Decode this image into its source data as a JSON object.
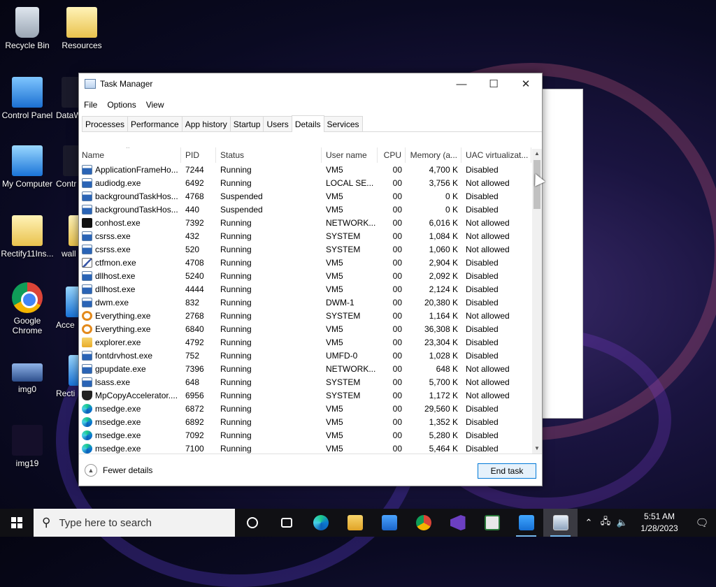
{
  "desktop": {
    "icons": [
      {
        "label": "Recycle Bin"
      },
      {
        "label": "Resources"
      },
      {
        "label": "Control Panel"
      },
      {
        "label": "DataW"
      },
      {
        "label": "My Computer"
      },
      {
        "label": "Contr"
      },
      {
        "label": "Rectify11Ins..."
      },
      {
        "label": "wall"
      },
      {
        "label": "Google Chrome"
      },
      {
        "label": "Acce"
      },
      {
        "label": "img0"
      },
      {
        "label": "Recti"
      },
      {
        "label": "img19"
      }
    ]
  },
  "window": {
    "title": "Task Manager",
    "minimize": "—",
    "maximize": "☐",
    "close": "✕",
    "menu": [
      "File",
      "Options",
      "View"
    ],
    "tabs": [
      "Processes",
      "Performance",
      "App history",
      "Startup",
      "Users",
      "Details",
      "Services"
    ],
    "active_tab": "Details",
    "columns": [
      "Name",
      "PID",
      "Status",
      "User name",
      "CPU",
      "Memory (a...",
      "UAC virtualizat..."
    ],
    "sort_arrow": "^",
    "rows": [
      {
        "name": "ApplicationFrameHo...",
        "pid": "7244",
        "status": "Running",
        "user": "VM5",
        "cpu": "00",
        "mem": "4,700 K",
        "uac": "Disabled",
        "icon": "window-icon"
      },
      {
        "name": "audiodg.exe",
        "pid": "6492",
        "status": "Running",
        "user": "LOCAL SE...",
        "cpu": "00",
        "mem": "3,756 K",
        "uac": "Not allowed",
        "icon": "window-icon"
      },
      {
        "name": "backgroundTaskHos...",
        "pid": "4768",
        "status": "Suspended",
        "user": "VM5",
        "cpu": "00",
        "mem": "0 K",
        "uac": "Disabled",
        "icon": "window-icon"
      },
      {
        "name": "backgroundTaskHos...",
        "pid": "440",
        "status": "Suspended",
        "user": "VM5",
        "cpu": "00",
        "mem": "0 K",
        "uac": "Disabled",
        "icon": "window-icon"
      },
      {
        "name": "conhost.exe",
        "pid": "7392",
        "status": "Running",
        "user": "NETWORK...",
        "cpu": "00",
        "mem": "6,016 K",
        "uac": "Not allowed",
        "icon": "console-icon"
      },
      {
        "name": "csrss.exe",
        "pid": "432",
        "status": "Running",
        "user": "SYSTEM",
        "cpu": "00",
        "mem": "1,084 K",
        "uac": "Not allowed",
        "icon": "window-icon"
      },
      {
        "name": "csrss.exe",
        "pid": "520",
        "status": "Running",
        "user": "SYSTEM",
        "cpu": "00",
        "mem": "1,060 K",
        "uac": "Not allowed",
        "icon": "window-icon"
      },
      {
        "name": "ctfmon.exe",
        "pid": "4708",
        "status": "Running",
        "user": "VM5",
        "cpu": "00",
        "mem": "2,904 K",
        "uac": "Disabled",
        "icon": "pen-icon"
      },
      {
        "name": "dllhost.exe",
        "pid": "5240",
        "status": "Running",
        "user": "VM5",
        "cpu": "00",
        "mem": "2,092 K",
        "uac": "Disabled",
        "icon": "window-icon"
      },
      {
        "name": "dllhost.exe",
        "pid": "4444",
        "status": "Running",
        "user": "VM5",
        "cpu": "00",
        "mem": "2,124 K",
        "uac": "Disabled",
        "icon": "window-icon"
      },
      {
        "name": "dwm.exe",
        "pid": "832",
        "status": "Running",
        "user": "DWM-1",
        "cpu": "00",
        "mem": "20,380 K",
        "uac": "Disabled",
        "icon": "window-icon"
      },
      {
        "name": "Everything.exe",
        "pid": "2768",
        "status": "Running",
        "user": "SYSTEM",
        "cpu": "00",
        "mem": "1,164 K",
        "uac": "Not allowed",
        "icon": "magnifier-icon"
      },
      {
        "name": "Everything.exe",
        "pid": "6840",
        "status": "Running",
        "user": "VM5",
        "cpu": "00",
        "mem": "36,308 K",
        "uac": "Disabled",
        "icon": "magnifier-icon"
      },
      {
        "name": "explorer.exe",
        "pid": "4792",
        "status": "Running",
        "user": "VM5",
        "cpu": "00",
        "mem": "23,304 K",
        "uac": "Disabled",
        "icon": "folder-icon"
      },
      {
        "name": "fontdrvhost.exe",
        "pid": "752",
        "status": "Running",
        "user": "UMFD-0",
        "cpu": "00",
        "mem": "1,028 K",
        "uac": "Disabled",
        "icon": "window-icon"
      },
      {
        "name": "gpupdate.exe",
        "pid": "7396",
        "status": "Running",
        "user": "NETWORK...",
        "cpu": "00",
        "mem": "648 K",
        "uac": "Not allowed",
        "icon": "window-icon"
      },
      {
        "name": "lsass.exe",
        "pid": "648",
        "status": "Running",
        "user": "SYSTEM",
        "cpu": "00",
        "mem": "5,700 K",
        "uac": "Not allowed",
        "icon": "window-icon"
      },
      {
        "name": "MpCopyAccelerator....",
        "pid": "6956",
        "status": "Running",
        "user": "SYSTEM",
        "cpu": "00",
        "mem": "1,172 K",
        "uac": "Not allowed",
        "icon": "shield-icon"
      },
      {
        "name": "msedge.exe",
        "pid": "6872",
        "status": "Running",
        "user": "VM5",
        "cpu": "00",
        "mem": "29,560 K",
        "uac": "Disabled",
        "icon": "edge-icon"
      },
      {
        "name": "msedge.exe",
        "pid": "6892",
        "status": "Running",
        "user": "VM5",
        "cpu": "00",
        "mem": "1,352 K",
        "uac": "Disabled",
        "icon": "edge-icon"
      },
      {
        "name": "msedge.exe",
        "pid": "7092",
        "status": "Running",
        "user": "VM5",
        "cpu": "00",
        "mem": "5,280 K",
        "uac": "Disabled",
        "icon": "edge-icon"
      },
      {
        "name": "msedge.exe",
        "pid": "7100",
        "status": "Running",
        "user": "VM5",
        "cpu": "00",
        "mem": "5,464 K",
        "uac": "Disabled",
        "icon": "edge-icon"
      }
    ],
    "fewer_details": "Fewer details",
    "end_task": "End task"
  },
  "taskbar": {
    "search_placeholder": "Type here to search",
    "apps": [
      "cortana-icon",
      "task-view-icon",
      "edge-icon",
      "file-explorer-icon",
      "store-icon",
      "chrome-icon",
      "visual-studio-icon",
      "news-icon",
      "windows-app-icon",
      "task-manager-icon"
    ],
    "time": "5:51 AM",
    "date": "1/28/2023"
  }
}
